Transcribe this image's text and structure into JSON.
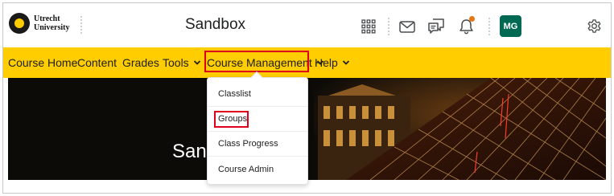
{
  "header": {
    "university": [
      "Utrecht",
      "University"
    ],
    "course_title": "Sandbox",
    "avatar_initials": "MG",
    "icons": [
      "apps-grid-icon",
      "mail-icon",
      "chat-icon",
      "bell-icon",
      "gear-icon"
    ],
    "notification_color": "#e87511",
    "avatar_color": "#006953"
  },
  "nav": {
    "background": "#ffcd00",
    "items": [
      {
        "label": "Course Home"
      },
      {
        "label": "Content"
      },
      {
        "label": "Grades"
      },
      {
        "label": "Tools"
      },
      {
        "label": "Course Management"
      },
      {
        "label": "Help"
      }
    ],
    "highlight_color": "#e0001b"
  },
  "banner": {
    "title": "San"
  },
  "dropdown": {
    "items": [
      {
        "label": "Classlist"
      },
      {
        "label": "Groups"
      },
      {
        "label": "Class Progress"
      },
      {
        "label": "Course Admin"
      }
    ]
  }
}
